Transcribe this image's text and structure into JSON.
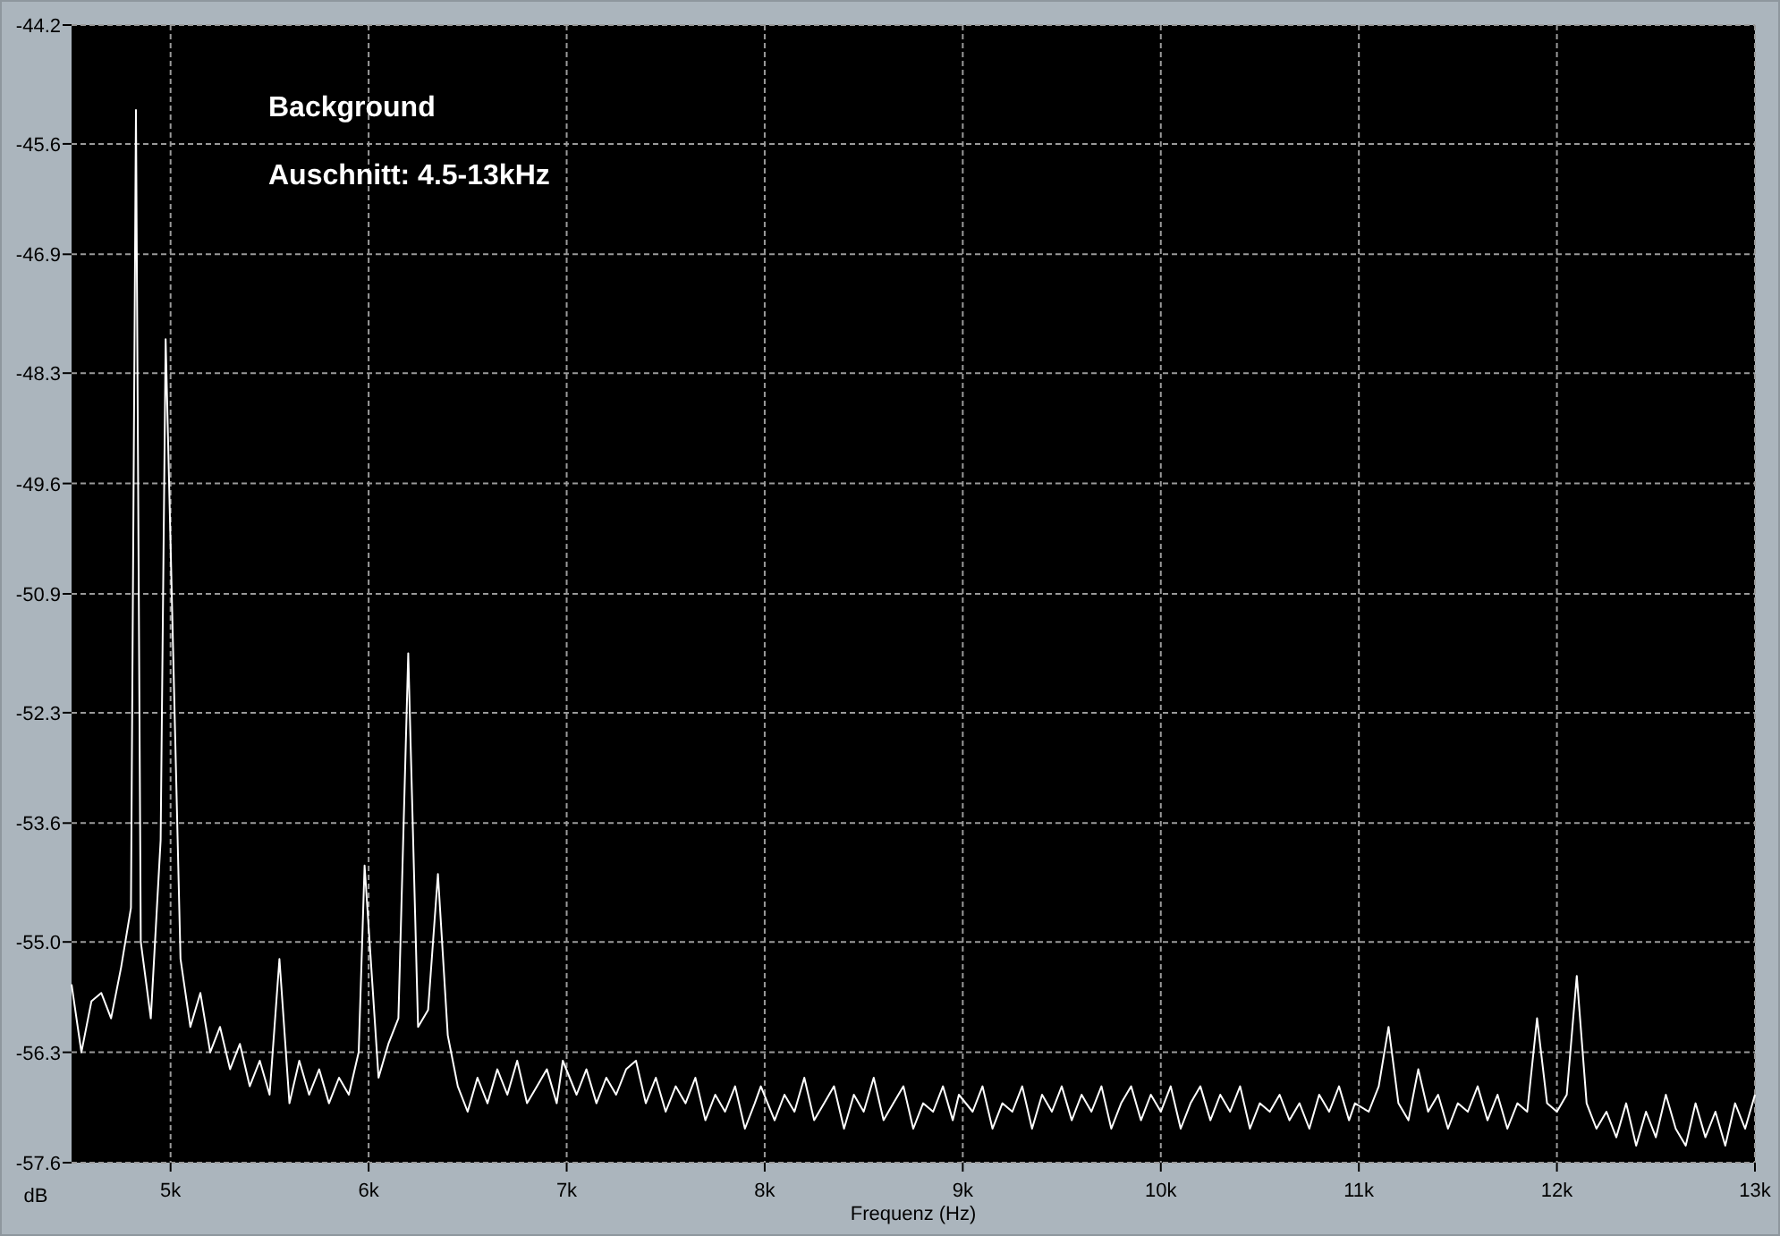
{
  "chart_data": {
    "type": "line",
    "xlabel": "Frequenz (Hz)",
    "ylabel": "dB",
    "grid": true,
    "annotations": [
      "Auschnitt: 4.5-13kHz"
    ],
    "xlim": [
      4500,
      13000
    ],
    "ylim": [
      -57.6,
      -44.2
    ],
    "xticks": [
      {
        "value": 5000,
        "label": "5k"
      },
      {
        "value": 6000,
        "label": "6k"
      },
      {
        "value": 7000,
        "label": "7k"
      },
      {
        "value": 8000,
        "label": "8k"
      },
      {
        "value": 9000,
        "label": "9k"
      },
      {
        "value": 10000,
        "label": "10k"
      },
      {
        "value": 11000,
        "label": "11k"
      },
      {
        "value": 12000,
        "label": "12k"
      },
      {
        "value": 13000,
        "label": "13k"
      }
    ],
    "yticks": [
      {
        "value": -44.2,
        "label": "-44.2"
      },
      {
        "value": -45.6,
        "label": "-45.6"
      },
      {
        "value": -46.9,
        "label": "-46.9"
      },
      {
        "value": -48.3,
        "label": "-48.3"
      },
      {
        "value": -49.6,
        "label": "-49.6"
      },
      {
        "value": -50.9,
        "label": "-50.9"
      },
      {
        "value": -52.3,
        "label": "-52.3"
      },
      {
        "value": -53.6,
        "label": "-53.6"
      },
      {
        "value": -55.0,
        "label": "-55.0"
      },
      {
        "value": -56.3,
        "label": "-56.3"
      },
      {
        "value": -57.6,
        "label": "-57.6"
      }
    ],
    "x": [
      4500,
      4550,
      4600,
      4650,
      4700,
      4750,
      4800,
      4825,
      4850,
      4900,
      4950,
      4975,
      5050,
      5100,
      5150,
      5200,
      5250,
      5300,
      5350,
      5400,
      5450,
      5500,
      5550,
      5600,
      5650,
      5700,
      5750,
      5800,
      5850,
      5900,
      5950,
      5980,
      6050,
      6100,
      6150,
      6200,
      6250,
      6300,
      6350,
      6400,
      6450,
      6500,
      6550,
      6600,
      6650,
      6700,
      6750,
      6800,
      6850,
      6900,
      6950,
      6980,
      7050,
      7100,
      7150,
      7200,
      7250,
      7300,
      7350,
      7400,
      7450,
      7500,
      7550,
      7600,
      7650,
      7700,
      7750,
      7800,
      7850,
      7900,
      7950,
      7980,
      8050,
      8100,
      8150,
      8200,
      8250,
      8300,
      8350,
      8400,
      8450,
      8500,
      8550,
      8600,
      8650,
      8700,
      8750,
      8800,
      8850,
      8900,
      8950,
      8980,
      9050,
      9100,
      9150,
      9200,
      9250,
      9300,
      9350,
      9400,
      9450,
      9500,
      9550,
      9600,
      9650,
      9700,
      9750,
      9800,
      9850,
      9900,
      9950,
      10000,
      10050,
      10100,
      10150,
      10200,
      10250,
      10300,
      10350,
      10400,
      10450,
      10500,
      10550,
      10600,
      10650,
      10700,
      10750,
      10800,
      10850,
      10900,
      10950,
      10980,
      11050,
      11100,
      11150,
      11200,
      11250,
      11300,
      11350,
      11400,
      11450,
      11500,
      11550,
      11600,
      11650,
      11700,
      11750,
      11800,
      11850,
      11900,
      11950,
      12000,
      12050,
      12100,
      12150,
      12200,
      12250,
      12300,
      12350,
      12400,
      12450,
      12500,
      12550,
      12600,
      12650,
      12700,
      12750,
      12800,
      12850,
      12900,
      12950,
      13000
    ],
    "series": [
      {
        "name": "Background",
        "color": "#ffffff",
        "values": [
          -55.5,
          -56.3,
          -55.7,
          -55.6,
          -55.9,
          -55.3,
          -54.6,
          -45.2,
          -55.0,
          -55.9,
          -53.8,
          -47.9,
          -55.2,
          -56.0,
          -55.6,
          -56.3,
          -56.0,
          -56.5,
          -56.2,
          -56.7,
          -56.4,
          -56.8,
          -55.2,
          -56.9,
          -56.4,
          -56.8,
          -56.5,
          -56.9,
          -56.6,
          -56.8,
          -56.3,
          -54.1,
          -56.6,
          -56.2,
          -55.9,
          -51.6,
          -56.0,
          -55.8,
          -54.2,
          -56.1,
          -56.7,
          -57.0,
          -56.6,
          -56.9,
          -56.5,
          -56.8,
          -56.4,
          -56.9,
          -56.7,
          -56.5,
          -56.9,
          -56.4,
          -56.8,
          -56.5,
          -56.9,
          -56.6,
          -56.8,
          -56.5,
          -56.4,
          -56.9,
          -56.6,
          -57.0,
          -56.7,
          -56.9,
          -56.6,
          -57.1,
          -56.8,
          -57.0,
          -56.7,
          -57.2,
          -56.9,
          -56.7,
          -57.1,
          -56.8,
          -57.0,
          -56.6,
          -57.1,
          -56.9,
          -56.7,
          -57.2,
          -56.8,
          -57.0,
          -56.6,
          -57.1,
          -56.9,
          -56.7,
          -57.2,
          -56.9,
          -57.0,
          -56.7,
          -57.1,
          -56.8,
          -57.0,
          -56.7,
          -57.2,
          -56.9,
          -57.0,
          -56.7,
          -57.2,
          -56.8,
          -57.0,
          -56.7,
          -57.1,
          -56.8,
          -57.0,
          -56.7,
          -57.2,
          -56.9,
          -56.7,
          -57.1,
          -56.8,
          -57.0,
          -56.7,
          -57.2,
          -56.9,
          -56.7,
          -57.1,
          -56.8,
          -57.0,
          -56.7,
          -57.2,
          -56.9,
          -57.0,
          -56.8,
          -57.1,
          -56.9,
          -57.2,
          -56.8,
          -57.0,
          -56.7,
          -57.1,
          -56.9,
          -57.0,
          -56.7,
          -56.0,
          -56.9,
          -57.1,
          -56.5,
          -57.0,
          -56.8,
          -57.2,
          -56.9,
          -57.0,
          -56.7,
          -57.1,
          -56.8,
          -57.2,
          -56.9,
          -57.0,
          -55.9,
          -56.9,
          -57.0,
          -56.8,
          -55.4,
          -56.9,
          -57.2,
          -57.0,
          -57.3,
          -56.9,
          -57.4,
          -57.0,
          -57.3,
          -56.8,
          -57.2,
          -57.4,
          -56.9,
          -57.3,
          -57.0,
          -57.4,
          -56.9,
          -57.2,
          -56.8
        ]
      }
    ]
  }
}
